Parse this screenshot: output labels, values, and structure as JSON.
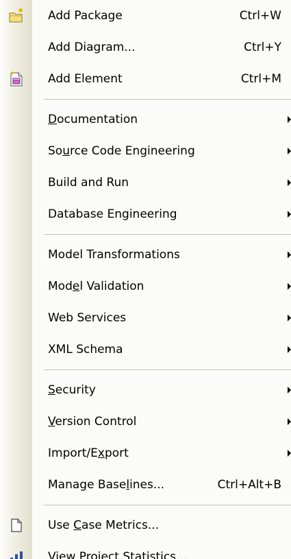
{
  "menu": {
    "groups": [
      {
        "items": [
          {
            "label": "Add Package",
            "shortcut": "Ctrl+W",
            "icon": "new-package-icon",
            "submenu": false
          },
          {
            "label": "Add Diagram...",
            "shortcut": "Ctrl+Y",
            "icon": "",
            "submenu": false
          },
          {
            "label": "Add Element",
            "shortcut": "Ctrl+M",
            "icon": "add-element-icon",
            "submenu": false
          }
        ]
      },
      {
        "items": [
          {
            "label": "Documentation",
            "underline": "D",
            "shortcut": "",
            "icon": "",
            "submenu": true
          },
          {
            "label": "Source Code Engineering",
            "underline": "u",
            "shortcut": "",
            "icon": "",
            "submenu": true
          },
          {
            "label": "Build and Run",
            "shortcut": "",
            "icon": "",
            "submenu": true
          },
          {
            "label": "Database Engineering",
            "shortcut": "",
            "icon": "",
            "submenu": true
          }
        ]
      },
      {
        "items": [
          {
            "label": "Model Transformations",
            "shortcut": "",
            "icon": "",
            "submenu": true
          },
          {
            "label": "Model Validation",
            "underline": "e",
            "shortcut": "",
            "icon": "",
            "submenu": true
          },
          {
            "label": "Web Services",
            "shortcut": "",
            "icon": "",
            "submenu": true
          },
          {
            "label": "XML Schema",
            "shortcut": "",
            "icon": "",
            "submenu": true
          }
        ]
      },
      {
        "items": [
          {
            "label": "Security",
            "underline": "S",
            "shortcut": "",
            "icon": "",
            "submenu": true
          },
          {
            "label": "Version Control",
            "underline": "V",
            "shortcut": "",
            "icon": "",
            "submenu": true
          },
          {
            "label": "Import/Export",
            "underline": "x",
            "shortcut": "",
            "icon": "",
            "submenu": true
          },
          {
            "label": "Manage Baselines...",
            "underline": "l",
            "shortcut": "Ctrl+Alt+B",
            "icon": "",
            "submenu": false
          }
        ]
      },
      {
        "items": [
          {
            "label": "Use Case Metrics...",
            "underline": "C",
            "shortcut": "",
            "icon": "document-icon",
            "submenu": false
          },
          {
            "label": "View Project Statistics...",
            "underline": "e",
            "shortcut": "",
            "icon": "bar-chart-icon",
            "submenu": false
          }
        ]
      }
    ]
  }
}
